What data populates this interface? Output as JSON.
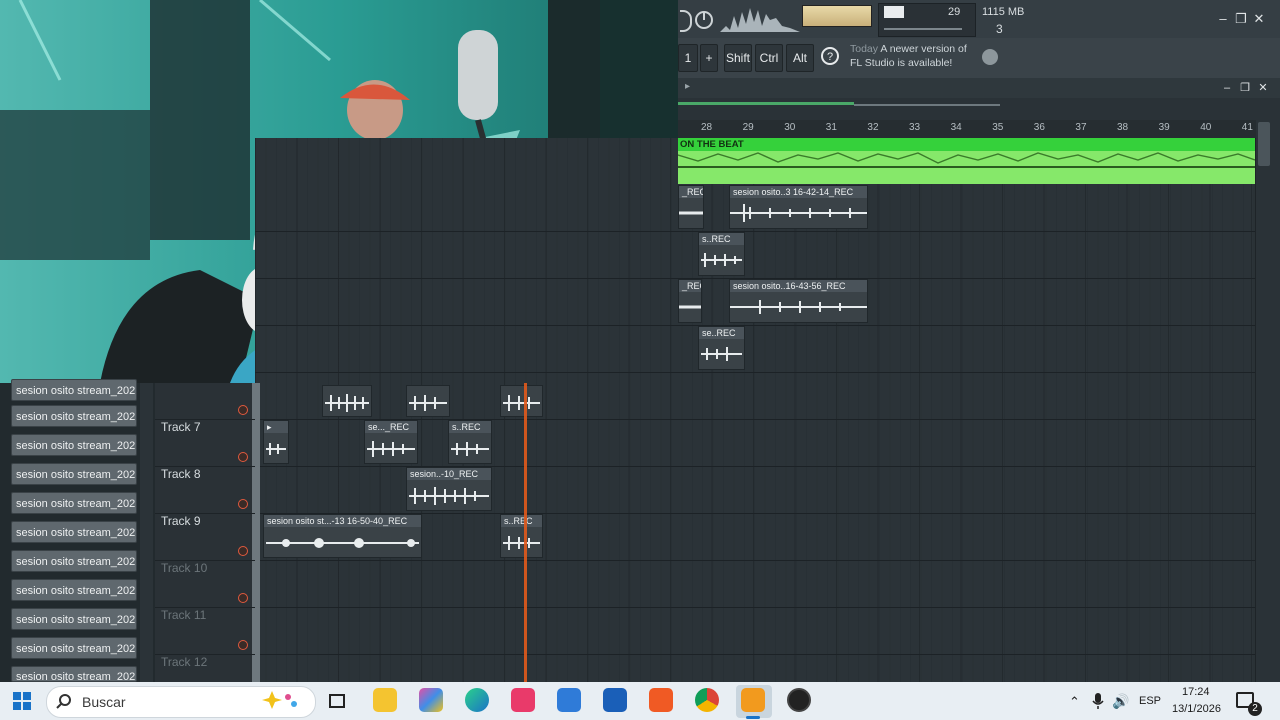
{
  "toolbar": {
    "cpu_value": "29",
    "memory": "1115 MB",
    "poly_value": "3",
    "keys": [
      "Shift",
      "Ctrl",
      "Alt"
    ],
    "pattern_num": "1",
    "plus": "+",
    "hint_day": "Today",
    "hint_line1": "A newer version of",
    "hint_line2": "FL Studio is available!"
  },
  "ruler": {
    "bars": [
      "28",
      "29",
      "30",
      "31",
      "32",
      "33",
      "34",
      "35",
      "36",
      "37",
      "38",
      "39",
      "40",
      "41"
    ]
  },
  "beat_clip": {
    "label": "ON THE BEAT",
    "color": "#35d13b"
  },
  "clips": {
    "r1a": "_REC",
    "r1b": "sesion osito..3 16-42-14_REC",
    "r2a": "s..REC",
    "r3a": "_REC",
    "r3b": "sesion osito..16-43-56_REC",
    "r4a": "se..REC",
    "t7a": "",
    "t7b": "se..._REC",
    "t7c": "s..REC",
    "t8a": "sesion..-10_REC",
    "t9a": "sesion osito st...-13 16-50-40_REC",
    "t9b": "s..REC"
  },
  "tracks": {
    "t6": "",
    "t7": "Track 7",
    "t8": "Track 8",
    "t9": "Track 9",
    "t10": "Track 10",
    "t11": "Track 11",
    "t12": "Track 12"
  },
  "browser": {
    "items": [
      "sesion osito stream_202...",
      "sesion osito stream_202...",
      "sesion osito stream_202...",
      "sesion osito stream_202...",
      "sesion osito stream_202...",
      "sesion osito stream_202...",
      "sesion osito stream_202...",
      "sesion osito stream_202...",
      "sesion osito stream_202...",
      "sesion osito stream_202...",
      "sesion osito stream_202..."
    ]
  },
  "taskbar": {
    "search_placeholder": "Buscar",
    "lang": "ESP",
    "time": "17:24",
    "date": "13/1/2026",
    "notif_count": "2"
  },
  "colors": {
    "accent": "#e15a1c",
    "beat": "#35d13b"
  }
}
